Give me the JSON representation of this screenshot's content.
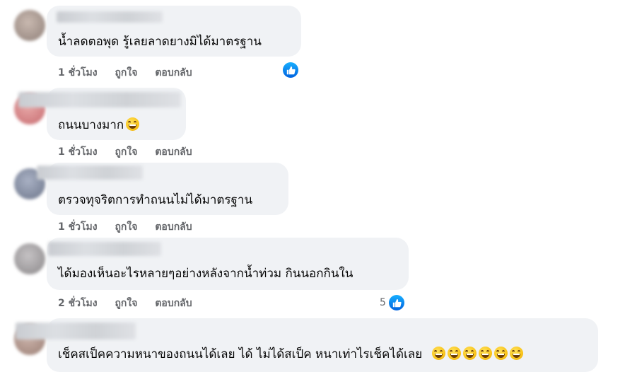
{
  "comments": [
    {
      "text": "น้ำลดตอพุด รู้เลยลาดยางมิได้มาตรฐาน",
      "time": "1 ชั่วโมง",
      "like_label": "ถูกใจ",
      "reply_label": "ตอบกลับ",
      "like_count": "",
      "emoji_count": 0,
      "avatar_color": "#b7a8a0"
    },
    {
      "text": "ถนนบางมาก",
      "time": "1 ชั่วโมง",
      "like_label": "ถูกใจ",
      "reply_label": "ตอบกลับ",
      "like_count": "",
      "emoji_count": 1,
      "avatar_color": "#d98a8c"
    },
    {
      "text": "ตรวจทุจริตการทำถนนไม่ได้มาตรฐาน",
      "time": "1 ชั่วโมง",
      "like_label": "ถูกใจ",
      "reply_label": "ตอบกลับ",
      "like_count": "",
      "emoji_count": 0,
      "avatar_color": "#8b93a6"
    },
    {
      "text": "ได้มองเห็นอะไรหลายๆอย่างหลังจากน้ำท่วม กินนอกกินใน",
      "time": "2 ชั่วโมง",
      "like_label": "ถูกใจ",
      "reply_label": "ตอบกลับ",
      "like_count": "5",
      "emoji_count": 0,
      "avatar_color": "#a9a6a8"
    },
    {
      "text": "เช็คสเป็คความหนาของถนนได้เลย ได้ ไม่ได้สเป็ค หนาเท่าไรเช็คได้เลย",
      "time": "",
      "like_label": "",
      "reply_label": "",
      "like_count": "",
      "emoji_count": 6,
      "avatar_color": "#b39a92"
    }
  ],
  "icons": {
    "like_reaction": "like-reaction-icon",
    "emoji": "grinning-face-emoji"
  },
  "colors": {
    "bubble": "#f0f2f5",
    "meta_text": "#65676b",
    "like_blue": "#1877f2"
  }
}
